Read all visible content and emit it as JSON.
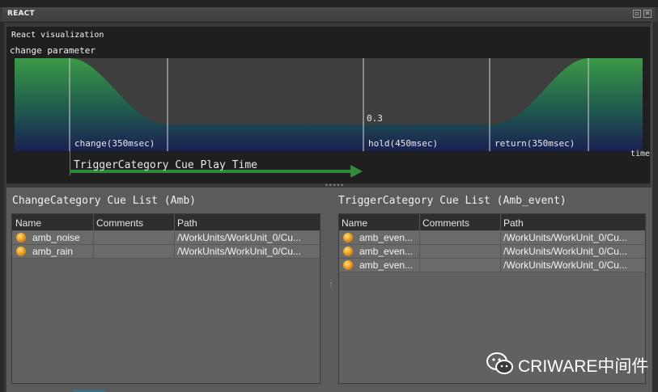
{
  "window": {
    "title": "REACT"
  },
  "viz": {
    "title": "React visualization",
    "parameter": "change parameter",
    "level": "0.3",
    "change_label": "change(350msec)",
    "hold_label": "hold(450msec)",
    "return_label": "return(350msec)",
    "time_label": "time",
    "trigger_label": "TriggerCategory Cue Play Time"
  },
  "left_panel": {
    "title": "ChangeCategory Cue List (Amb)",
    "columns": [
      "Name",
      "Comments",
      "Path"
    ],
    "rows": [
      {
        "name": "amb_noise",
        "comments": "",
        "path": "/WorkUnits/WorkUnit_0/Cu..."
      },
      {
        "name": "amb_rain",
        "comments": "",
        "path": "/WorkUnits/WorkUnit_0/Cu..."
      }
    ]
  },
  "right_panel": {
    "title": "TriggerCategory Cue List (Amb_event)",
    "columns": [
      "Name",
      "Comments",
      "Path"
    ],
    "rows": [
      {
        "name": "amb_even...",
        "comments": "",
        "path": "/WorkUnits/WorkUnit_0/Cu..."
      },
      {
        "name": "amb_even...",
        "comments": "",
        "path": "/WorkUnits/WorkUnit_0/Cu..."
      },
      {
        "name": "amb_even...",
        "comments": "",
        "path": "/WorkUnits/WorkUnit_0/Cu..."
      }
    ]
  },
  "watermark": {
    "text": "CRIWARE中间件",
    "icon": "wechat-icon"
  },
  "colors": {
    "curve_top": "#2f8a3c",
    "curve_bottom": "#1d2a55",
    "arrow": "#2e8b3a"
  }
}
